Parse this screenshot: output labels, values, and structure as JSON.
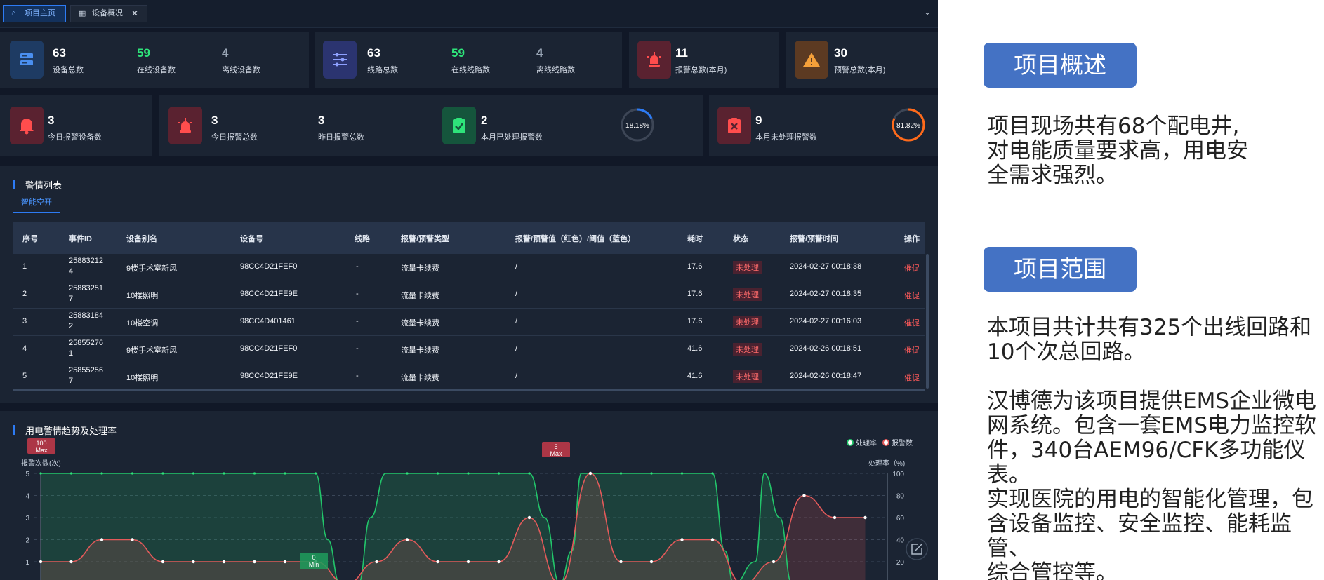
{
  "tabs": {
    "home": "项目主页",
    "overview": "设备概况",
    "close_glyph": "✕",
    "collapse_glyph": "⌄"
  },
  "stats_row1": {
    "devices": [
      {
        "value": "63",
        "label": "设备总数"
      },
      {
        "value": "59",
        "label": "在线设备数"
      },
      {
        "value": "4",
        "label": "离线设备数"
      }
    ],
    "lines": [
      {
        "value": "63",
        "label": "线路总数"
      },
      {
        "value": "59",
        "label": "在线线路数"
      },
      {
        "value": "4",
        "label": "离线线路数"
      }
    ],
    "alarm_month": {
      "value": "11",
      "label": "报警总数(本月)"
    },
    "warning_month": {
      "value": "30",
      "label": "预警总数(本月)"
    }
  },
  "stats_row2": {
    "today_devices": {
      "value": "3",
      "label": "今日报警设备数"
    },
    "today_alarms": {
      "value": "3",
      "label": "今日报警总数"
    },
    "yesterday_alarms": {
      "value": "3",
      "label": "昨日报警总数"
    },
    "handled": {
      "value": "2",
      "label": "本月已处理报警数",
      "percent_text": "18.18%",
      "percent": 18.18,
      "color": "#2d7bf4"
    },
    "unhandled": {
      "value": "9",
      "label": "本月未处理报警数",
      "percent_text": "81.82%",
      "percent": 81.82,
      "color": "#ff6a1a"
    }
  },
  "alarm_list": {
    "title": "警情列表",
    "subtab": "智能空开",
    "columns": [
      "序号",
      "事件ID",
      "设备别名",
      "设备号",
      "线路",
      "报警/预警类型",
      "报警/预警值（红色）/阈值（蓝色）",
      "耗时",
      "状态",
      "报警/预警时间",
      "操作"
    ],
    "rows": [
      {
        "no": "1",
        "id1": "25883212",
        "id2": "4",
        "alias": "9楼手术室新风",
        "device": "98CC4D21FEF0",
        "line": "-",
        "type": "流量卡续费",
        "value": "/",
        "time": "17.6",
        "status": "未处理",
        "datetime": "2024-02-27 00:18:38",
        "action": "催促"
      },
      {
        "no": "2",
        "id1": "25883251",
        "id2": "7",
        "alias": "10楼照明",
        "device": "98CC4D21FE9E",
        "line": "-",
        "type": "流量卡续费",
        "value": "/",
        "time": "17.6",
        "status": "未处理",
        "datetime": "2024-02-27 00:18:35",
        "action": "催促"
      },
      {
        "no": "3",
        "id1": "25883184",
        "id2": "2",
        "alias": "10楼空调",
        "device": "98CC4D401461",
        "line": "-",
        "type": "流量卡续费",
        "value": "/",
        "time": "17.6",
        "status": "未处理",
        "datetime": "2024-02-27 00:16:03",
        "action": "催促"
      },
      {
        "no": "4",
        "id1": "25855276",
        "id2": "1",
        "alias": "9楼手术室新风",
        "device": "98CC4D21FEF0",
        "line": "-",
        "type": "流量卡续费",
        "value": "/",
        "time": "41.6",
        "status": "未处理",
        "datetime": "2024-02-26 00:18:51",
        "action": "催促"
      },
      {
        "no": "5",
        "id1": "25855256",
        "id2": "7",
        "alias": "10楼照明",
        "device": "98CC4D21FE9E",
        "line": "-",
        "type": "流量卡续费",
        "value": "/",
        "time": "41.6",
        "status": "未处理",
        "datetime": "2024-02-26 00:18:47",
        "action": "催促"
      }
    ]
  },
  "trend": {
    "title": "用电警情趋势及处理率",
    "legend_rate": "处理率",
    "legend_count": "报警数",
    "left_axis_title": "报警次数(次)",
    "right_axis_title": "处理率（%)",
    "max_left_label": "Max",
    "max_left_value": "100",
    "max_right_label": "Max",
    "max_right_value": "5",
    "min_label": "Min",
    "min_value": "0"
  },
  "chart_data": {
    "type": "area",
    "ylim_left": [
      0,
      5
    ],
    "ylim_right": [
      0,
      100
    ],
    "left_ticks": [
      "5",
      "4",
      "3",
      "2",
      "1"
    ],
    "right_ticks": [
      "100",
      "80",
      "60",
      "40",
      "20"
    ],
    "series": [
      {
        "name": "处理率",
        "axis": "right",
        "color": "#22c56a",
        "points": [
          [
            0,
            100
          ],
          [
            1,
            100
          ],
          [
            2,
            100
          ],
          [
            3,
            100
          ],
          [
            4,
            100
          ],
          [
            5,
            100
          ],
          [
            6,
            100
          ],
          [
            7,
            100
          ],
          [
            8,
            100
          ],
          [
            9,
            100
          ],
          [
            9.4,
            40
          ],
          [
            9.8,
            0
          ],
          [
            10.4,
            0
          ],
          [
            10.8,
            60
          ],
          [
            11.3,
            100
          ],
          [
            12,
            100
          ],
          [
            13,
            100
          ],
          [
            14,
            100
          ],
          [
            15,
            100
          ],
          [
            16,
            100
          ],
          [
            16.5,
            60
          ],
          [
            17,
            0
          ],
          [
            17.4,
            30
          ],
          [
            17.7,
            100
          ],
          [
            18,
            100
          ],
          [
            19,
            100
          ],
          [
            20,
            100
          ],
          [
            21,
            100
          ],
          [
            22,
            100
          ],
          [
            22.4,
            30
          ],
          [
            22.7,
            0
          ],
          [
            23.4,
            20
          ],
          [
            23.7,
            100
          ],
          [
            24.2,
            60
          ],
          [
            24.6,
            0
          ]
        ]
      },
      {
        "name": "报警数",
        "axis": "left",
        "color": "#e35a5a",
        "points": [
          [
            0,
            1
          ],
          [
            1,
            1
          ],
          [
            2,
            2
          ],
          [
            3,
            2
          ],
          [
            4,
            1
          ],
          [
            5,
            1
          ],
          [
            6,
            1
          ],
          [
            7,
            1
          ],
          [
            8,
            1
          ],
          [
            9,
            1
          ],
          [
            10,
            0
          ],
          [
            11,
            1
          ],
          [
            12,
            2
          ],
          [
            13,
            1
          ],
          [
            14,
            1
          ],
          [
            15,
            1
          ],
          [
            16,
            3
          ],
          [
            17,
            0
          ],
          [
            18,
            5
          ],
          [
            19,
            1
          ],
          [
            20,
            1
          ],
          [
            21,
            2
          ],
          [
            22,
            2
          ],
          [
            23,
            0
          ],
          [
            24,
            1
          ],
          [
            25,
            4
          ],
          [
            26,
            3
          ],
          [
            27,
            3
          ]
        ]
      }
    ]
  },
  "doc": {
    "overview_title": "项目概述",
    "overview_lines": [
      "项目现场共有68个配电井,",
      "对电能质量要求高，用电安",
      "全需求强烈。"
    ],
    "scope_title": "项目范围",
    "scope_lines_1": [
      "本项目共计共有325个出线回路和",
      "10个次总回路。"
    ],
    "scope_lines_2": [
      "汉博德为该项目提供EMS企业微电",
      "网系统。包含一套EMS电力监控软",
      "件，340台AEM96/CFK多功能仪表。",
      "实现医院的用电的智能化管理，包",
      "含设备监控、安全监控、能耗监管、",
      "综合管控等。"
    ]
  }
}
